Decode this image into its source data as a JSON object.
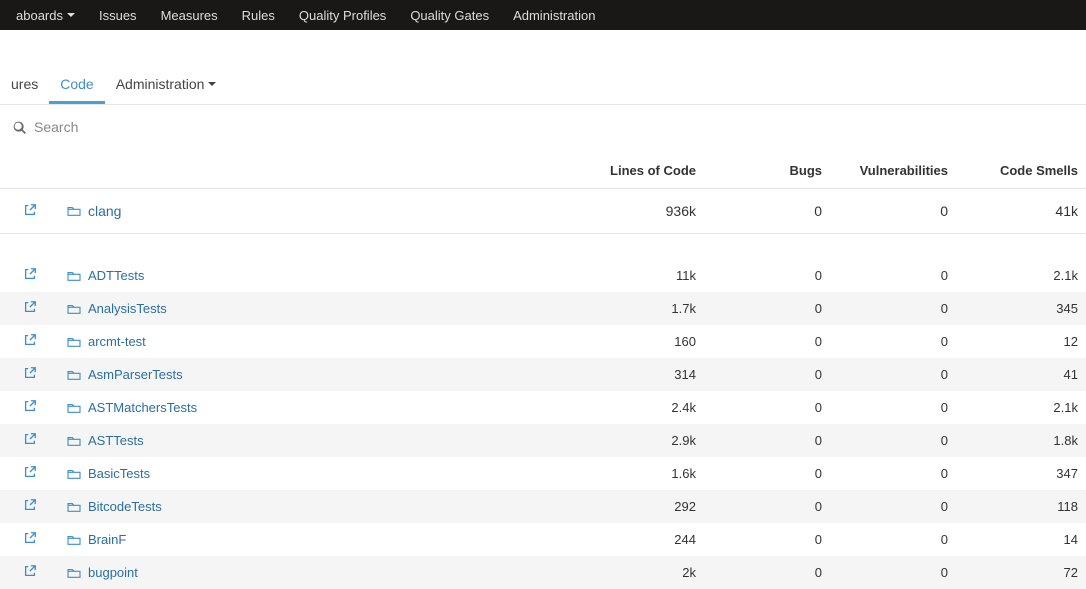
{
  "topnav": {
    "items": [
      {
        "label": "aboards",
        "hasCaret": true
      },
      {
        "label": "Issues",
        "hasCaret": false
      },
      {
        "label": "Measures",
        "hasCaret": false
      },
      {
        "label": "Rules",
        "hasCaret": false
      },
      {
        "label": "Quality Profiles",
        "hasCaret": false
      },
      {
        "label": "Quality Gates",
        "hasCaret": false
      },
      {
        "label": "Administration",
        "hasCaret": false
      }
    ]
  },
  "subnav": {
    "items": [
      {
        "label": "ures",
        "active": false,
        "hasCaret": false
      },
      {
        "label": "Code",
        "active": true,
        "hasCaret": false
      },
      {
        "label": "Administration",
        "active": false,
        "hasCaret": true
      }
    ]
  },
  "search": {
    "placeholder": "Search"
  },
  "columns": {
    "loc": "Lines of Code",
    "bugs": "Bugs",
    "vuln": "Vulnerabilities",
    "smells": "Code Smells"
  },
  "project": {
    "name": "clang",
    "loc": "936k",
    "bugs": "0",
    "vuln": "0",
    "smells": "41k"
  },
  "rows": [
    {
      "name": "ADTTests",
      "loc": "11k",
      "bugs": "0",
      "vuln": "0",
      "smells": "2.1k"
    },
    {
      "name": "AnalysisTests",
      "loc": "1.7k",
      "bugs": "0",
      "vuln": "0",
      "smells": "345"
    },
    {
      "name": "arcmt-test",
      "loc": "160",
      "bugs": "0",
      "vuln": "0",
      "smells": "12"
    },
    {
      "name": "AsmParserTests",
      "loc": "314",
      "bugs": "0",
      "vuln": "0",
      "smells": "41"
    },
    {
      "name": "ASTMatchersTests",
      "loc": "2.4k",
      "bugs": "0",
      "vuln": "0",
      "smells": "2.1k"
    },
    {
      "name": "ASTTests",
      "loc": "2.9k",
      "bugs": "0",
      "vuln": "0",
      "smells": "1.8k"
    },
    {
      "name": "BasicTests",
      "loc": "1.6k",
      "bugs": "0",
      "vuln": "0",
      "smells": "347"
    },
    {
      "name": "BitcodeTests",
      "loc": "292",
      "bugs": "0",
      "vuln": "0",
      "smells": "118"
    },
    {
      "name": "BrainF",
      "loc": "244",
      "bugs": "0",
      "vuln": "0",
      "smells": "14"
    },
    {
      "name": "bugpoint",
      "loc": "2k",
      "bugs": "0",
      "vuln": "0",
      "smells": "72"
    }
  ]
}
